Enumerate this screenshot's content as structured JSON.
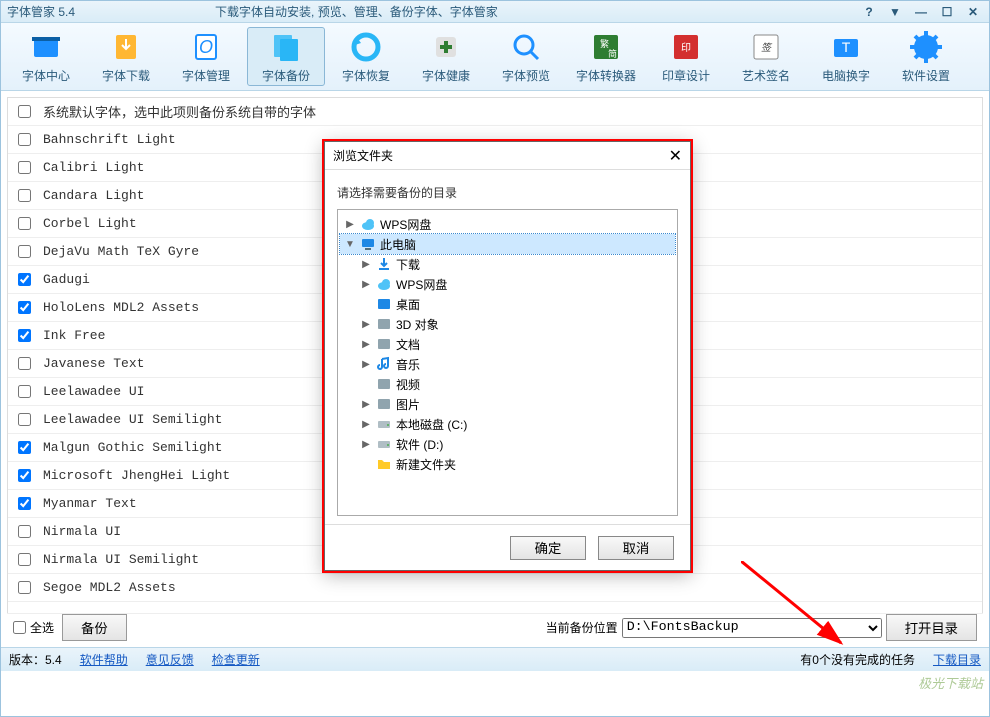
{
  "window": {
    "title": "字体管家 5.4",
    "subtitle": "下载字体自动安装, 预览、管理、备份字体、字体管家"
  },
  "toolbar": [
    {
      "id": "center",
      "label": "字体中心",
      "active": false
    },
    {
      "id": "download",
      "label": "字体下载",
      "active": false
    },
    {
      "id": "manage",
      "label": "字体管理",
      "active": false
    },
    {
      "id": "backup",
      "label": "字体备份",
      "active": true
    },
    {
      "id": "restore",
      "label": "字体恢复",
      "active": false
    },
    {
      "id": "health",
      "label": "字体健康",
      "active": false
    },
    {
      "id": "preview",
      "label": "字体预览",
      "active": false
    },
    {
      "id": "convert",
      "label": "字体转换器",
      "active": false
    },
    {
      "id": "seal",
      "label": "印章设计",
      "active": false
    },
    {
      "id": "sign",
      "label": "艺术签名",
      "active": false
    },
    {
      "id": "swap",
      "label": "电脑换字",
      "active": false
    },
    {
      "id": "settings",
      "label": "软件设置",
      "active": false
    }
  ],
  "fonts": [
    {
      "name": "系统默认字体，选中此项则备份系统自带的字体",
      "checked": false
    },
    {
      "name": "Bahnschrift Light",
      "checked": false
    },
    {
      "name": "Calibri Light",
      "checked": false
    },
    {
      "name": "Candara Light",
      "checked": false
    },
    {
      "name": "Corbel Light",
      "checked": false
    },
    {
      "name": "DejaVu Math TeX Gyre",
      "checked": false
    },
    {
      "name": "Gadugi",
      "checked": true
    },
    {
      "name": "HoloLens MDL2 Assets",
      "checked": true
    },
    {
      "name": "Ink Free",
      "checked": true
    },
    {
      "name": "Javanese Text",
      "checked": false
    },
    {
      "name": "Leelawadee UI",
      "checked": false
    },
    {
      "name": "Leelawadee UI Semilight",
      "checked": false
    },
    {
      "name": "Malgun Gothic Semilight",
      "checked": true
    },
    {
      "name": "Microsoft JhengHei Light",
      "checked": true
    },
    {
      "name": "Myanmar Text",
      "checked": true
    },
    {
      "name": "Nirmala UI",
      "checked": false
    },
    {
      "name": "Nirmala UI Semilight",
      "checked": false
    },
    {
      "name": "Segoe MDL2 Assets",
      "checked": false
    }
  ],
  "bottom": {
    "select_all": "全选",
    "backup_btn": "备份",
    "loc_label": "当前备份位置",
    "loc_value": "D:\\FontsBackup",
    "open_dir": "打开目录"
  },
  "status": {
    "version": "版本：5.4",
    "help": "软件帮助",
    "feedback": "意见反馈",
    "update": "检查更新",
    "tasks": "有0个没有完成的任务",
    "dl_dir": "下载目录"
  },
  "dialog": {
    "title": "浏览文件夹",
    "msg": "请选择需要备份的目录",
    "ok": "确定",
    "cancel": "取消",
    "tree": [
      {
        "lvl": 1,
        "exp": ">",
        "icon": "cloud",
        "label": "WPS网盘",
        "sel": false
      },
      {
        "lvl": 1,
        "exp": "v",
        "icon": "pc",
        "label": "此电脑",
        "sel": true
      },
      {
        "lvl": 2,
        "exp": ">",
        "icon": "down",
        "label": "下载",
        "sel": false
      },
      {
        "lvl": 2,
        "exp": ">",
        "icon": "cloud",
        "label": "WPS网盘",
        "sel": false
      },
      {
        "lvl": 2,
        "exp": "",
        "icon": "desk",
        "label": "桌面",
        "sel": false
      },
      {
        "lvl": 2,
        "exp": ">",
        "icon": "3d",
        "label": "3D 对象",
        "sel": false
      },
      {
        "lvl": 2,
        "exp": ">",
        "icon": "doc",
        "label": "文档",
        "sel": false
      },
      {
        "lvl": 2,
        "exp": ">",
        "icon": "music",
        "label": "音乐",
        "sel": false
      },
      {
        "lvl": 2,
        "exp": "",
        "icon": "video",
        "label": "视频",
        "sel": false
      },
      {
        "lvl": 2,
        "exp": ">",
        "icon": "pic",
        "label": "图片",
        "sel": false
      },
      {
        "lvl": 2,
        "exp": ">",
        "icon": "disk",
        "label": "本地磁盘 (C:)",
        "sel": false
      },
      {
        "lvl": 2,
        "exp": ">",
        "icon": "disk",
        "label": "软件 (D:)",
        "sel": false
      },
      {
        "lvl": 2,
        "exp": "",
        "icon": "folder",
        "label": "新建文件夹",
        "sel": false
      }
    ]
  },
  "watermark": "极光下载站"
}
